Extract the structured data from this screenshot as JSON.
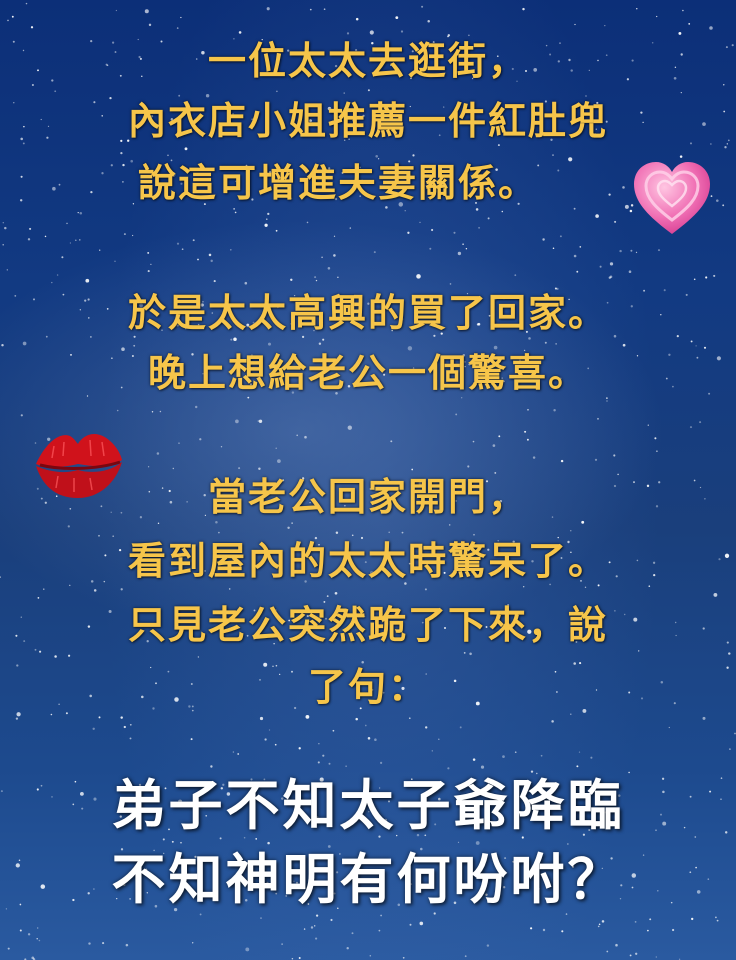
{
  "paragraph1": {
    "line1": "一位太太去逛街，",
    "line2": "內衣店小姐推薦一件紅肚兜",
    "line3": "說這可增進夫妻關係。"
  },
  "paragraph2": {
    "line1": "於是太太高興的買了回家。",
    "line2": "晚上想給老公一個驚喜。"
  },
  "paragraph3": {
    "line1": "當老公回家開門，",
    "line2": "看到屋內的太太時驚呆了。",
    "line3": "只見老公突然跪了下來，說",
    "line4": "了句："
  },
  "punchline": {
    "line1": "弟子不知太子爺降臨",
    "line2": "不知神明有何吩咐？"
  },
  "icons": {
    "heart": "growing-heart-icon",
    "lips": "kiss-mark-icon"
  },
  "colors": {
    "text_gold": "#f6c54a",
    "text_white": "#ffffff",
    "background": "#143b80"
  }
}
